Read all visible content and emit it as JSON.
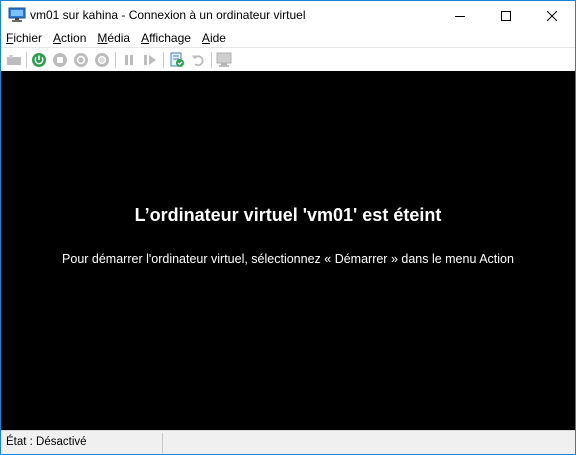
{
  "window": {
    "title": "vm01 sur kahina - Connexion à un ordinateur virtuel",
    "icon": "vm-connection-icon"
  },
  "menu": [
    {
      "label": "Fichier",
      "accel": "F",
      "rest": "ichier"
    },
    {
      "label": "Action",
      "accel": "A",
      "rest": "ction"
    },
    {
      "label": "Média",
      "accel": "M",
      "rest": "édia"
    },
    {
      "label": "Affichage",
      "accel": "A",
      "rest": "ffichage"
    },
    {
      "label": "Aide",
      "accel": "A",
      "rest": "ide"
    }
  ],
  "toolbar": {
    "buttons": [
      "ctrl-alt-del-icon",
      "start-icon",
      "turn-off-icon",
      "shut-down-icon",
      "save-icon",
      "pause-icon",
      "reset-icon",
      "checkpoint-icon",
      "revert-icon",
      "enhanced-session-icon"
    ]
  },
  "screen": {
    "headline": "L’ordinateur virtuel 'vm01' est éteint",
    "message": "Pour démarrer l'ordinateur virtuel, sélectionnez « Démarrer » dans le menu Action"
  },
  "status": {
    "text": "État : Désactivé"
  },
  "colors": {
    "start_green": "#2e9e4f",
    "window_border": "#1883d7",
    "screen_bg": "#000000"
  }
}
